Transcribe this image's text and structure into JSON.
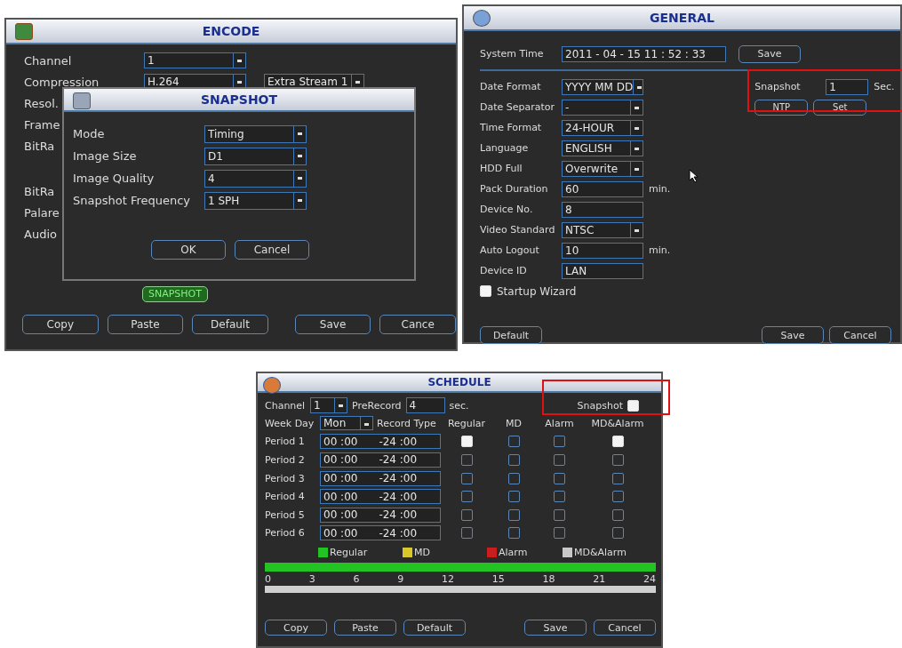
{
  "encode": {
    "title": "ENCODE",
    "rows": [
      {
        "label": "Channel",
        "fields": [
          {
            "value": "1"
          }
        ]
      },
      {
        "label": "Compression",
        "fields": [
          {
            "value": "H.264"
          },
          {
            "value": "Extra Stream 1"
          }
        ]
      },
      {
        "label": "Resol.",
        "fields": []
      },
      {
        "label": "Frame",
        "fields": []
      },
      {
        "label": "BitRa",
        "fields": []
      },
      {
        "label": "BitRa",
        "fields": []
      },
      {
        "label": "Palare",
        "fields": []
      },
      {
        "label": "Audio",
        "fields": []
      }
    ],
    "snapshot_button": "SNAPSHOT",
    "buttons": [
      "Copy",
      "Paste",
      "Default",
      "Save",
      "Cance"
    ],
    "dialog": {
      "title": "SNAPSHOT",
      "rows": [
        {
          "label": "Mode",
          "value": "Timing"
        },
        {
          "label": "Image Size",
          "value": "D1"
        },
        {
          "label": "Image Quality",
          "value": "4"
        },
        {
          "label": "Snapshot Frequency",
          "value": "1 SPH"
        }
      ],
      "buttons": [
        "OK",
        "Cancel"
      ]
    }
  },
  "general": {
    "title": "GENERAL",
    "system_time": {
      "label": "System Time",
      "value": "2011 - 04 - 15  11 : 52 : 33",
      "button": "Save"
    },
    "rows": [
      {
        "label": "Date Format",
        "value": "YYYY MM DD",
        "kind": "select"
      },
      {
        "label": "Date Separator",
        "value": "-",
        "kind": "select"
      },
      {
        "label": "Time Format",
        "value": "24-HOUR",
        "kind": "select"
      },
      {
        "label": "Language",
        "value": "ENGLISH",
        "kind": "select"
      },
      {
        "label": "HDD Full",
        "value": "Overwrite",
        "kind": "select"
      },
      {
        "label": "Pack Duration",
        "value": "60",
        "kind": "input",
        "unit": "min."
      },
      {
        "label": "Device No.",
        "value": "8",
        "kind": "input"
      },
      {
        "label": "Video Standard",
        "value": "NTSC",
        "kind": "select"
      },
      {
        "label": "Auto Logout",
        "value": "10",
        "kind": "input",
        "unit": "min."
      },
      {
        "label": "Device ID",
        "value": "LAN",
        "kind": "input"
      }
    ],
    "startup_wizard": {
      "label": "Startup Wizard",
      "checked": true
    },
    "snapshot": {
      "label": "Snapshot",
      "value": "1",
      "unit": "Sec.",
      "buttons": [
        "NTP",
        "Set"
      ],
      "highlighted": true
    },
    "buttons_left": [
      "Default"
    ],
    "buttons_right": [
      "Save",
      "Cancel"
    ]
  },
  "schedule": {
    "title": "SCHEDULE",
    "channel": {
      "label": "Channel",
      "value": "1"
    },
    "prerecord": {
      "label": "PreRecord",
      "value": "4",
      "unit": "sec."
    },
    "snapshot": {
      "label": "Snapshot",
      "checked": true,
      "highlighted": true
    },
    "week_day": {
      "label": "Week Day",
      "value": "Mon"
    },
    "record_type_label": "Record Type",
    "columns": [
      "Regular",
      "MD",
      "Alarm",
      "MD&Alarm"
    ],
    "periods": [
      {
        "label": "Period 1",
        "start": "00 :00",
        "end": "-24 :00",
        "checks": [
          true,
          false,
          false,
          true
        ]
      },
      {
        "label": "Period 2",
        "start": "00 :00",
        "end": "-24 :00",
        "checks": [
          false,
          false,
          false,
          false
        ]
      },
      {
        "label": "Period 3",
        "start": "00 :00",
        "end": "-24 :00",
        "checks": [
          false,
          false,
          false,
          false
        ]
      },
      {
        "label": "Period 4",
        "start": "00 :00",
        "end": "-24 :00",
        "checks": [
          false,
          false,
          false,
          false
        ]
      },
      {
        "label": "Period 5",
        "start": "00 :00",
        "end": "-24 :00",
        "checks": [
          false,
          false,
          false,
          false
        ]
      },
      {
        "label": "Period 6",
        "start": "00 :00",
        "end": "-24 :00",
        "checks": [
          false,
          false,
          false,
          false
        ]
      }
    ],
    "legend": [
      {
        "label": "Regular",
        "color": "#22c322"
      },
      {
        "label": "MD",
        "color": "#d8c82a"
      },
      {
        "label": "Alarm",
        "color": "#c81e1e"
      },
      {
        "label": "MD&Alarm",
        "color": "#c8c8c8"
      }
    ],
    "hours": [
      "0",
      "3",
      "6",
      "9",
      "12",
      "15",
      "18",
      "21",
      "24"
    ],
    "buttons_left": [
      "Copy",
      "Paste",
      "Default"
    ],
    "buttons_right": [
      "Save",
      "Cancel"
    ]
  }
}
